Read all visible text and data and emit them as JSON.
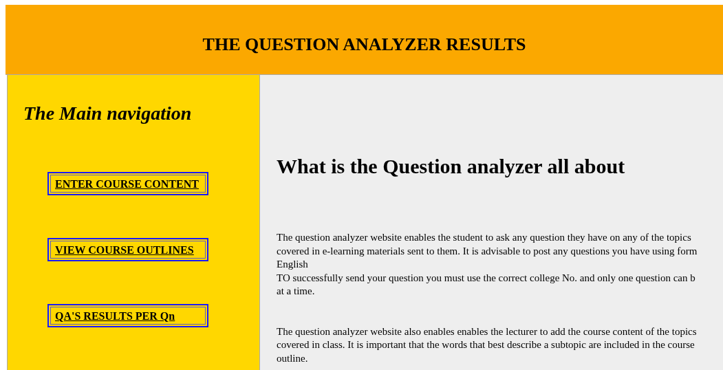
{
  "header": {
    "title": "THE QUESTION ANALYZER RESULTS"
  },
  "sidebar": {
    "heading": "The Main navigation",
    "links": [
      {
        "label": "ENTER COURSE CONTENT"
      },
      {
        "label": "VIEW COURSE OUTLINES"
      },
      {
        "label": "QA'S RESULTS PER Qn"
      }
    ]
  },
  "main": {
    "heading": "What is the Question analyzer all about",
    "paragraphs": [
      {
        "text": "The question analyzer website enables the student to ask any question they have on any of the topics\ncovered in e-learning materials sent to them. It is advisable to post any questions you have using form\nEnglish\nTO successfully send your question you must use the correct college No. and only one question can b\nat a time."
      },
      {
        "text": "The question analyzer website also enables enables the lecturer to add the course content of the topics\ncovered in class. It is important that the words that best describe a subtopic are included in the course\noutline."
      }
    ]
  }
}
